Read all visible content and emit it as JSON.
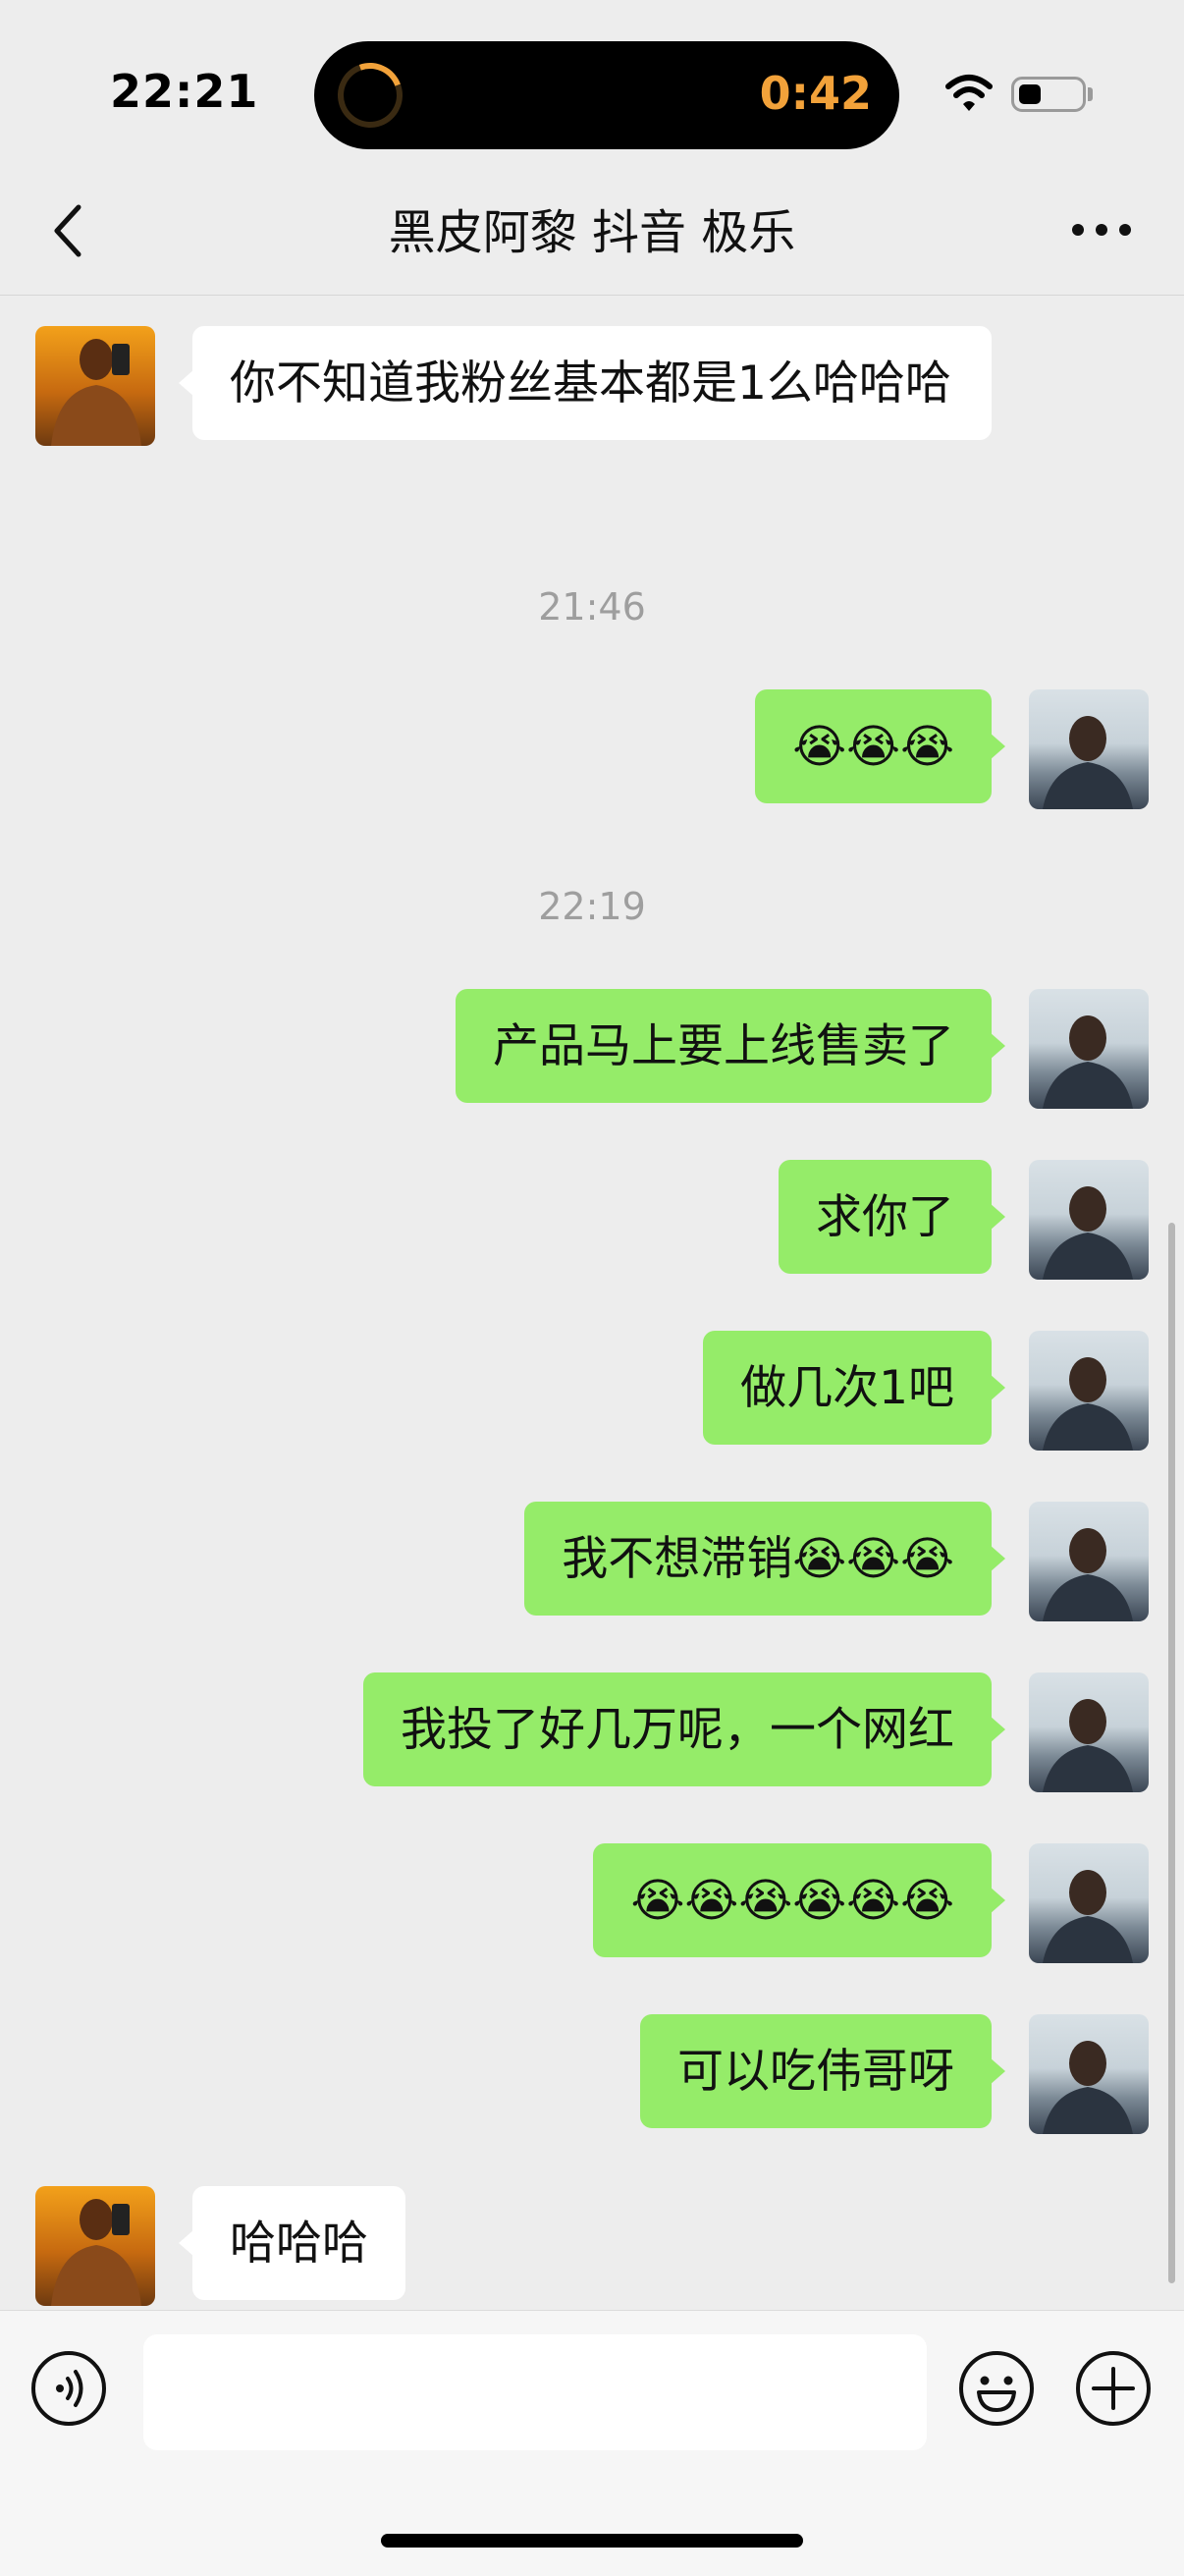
{
  "status_bar": {
    "time": "22:21",
    "island_timer": "0:42",
    "island_timer_color": "#F2A23A"
  },
  "header": {
    "title": "黑皮阿黎 抖音 极乐"
  },
  "colors": {
    "background": "#EDEDED",
    "my_bubble": "#95EC69",
    "peer_bubble": "#FFFFFF",
    "timestamp": "#9E9E9E"
  },
  "messages": [
    {
      "sender": "peer",
      "text": "你不知道我粉丝基本都是1么哈哈哈"
    },
    {
      "type": "time",
      "text": "21:46"
    },
    {
      "sender": "me",
      "text": "😭😭😭"
    },
    {
      "type": "time",
      "text": "22:19"
    },
    {
      "sender": "me",
      "text": "产品马上要上线售卖了"
    },
    {
      "sender": "me",
      "text": "求你了"
    },
    {
      "sender": "me",
      "text": "做几次1吧"
    },
    {
      "sender": "me",
      "text": "我不想滞销😭😭😭"
    },
    {
      "sender": "me",
      "text": "我投了好几万呢，一个网红"
    },
    {
      "sender": "me",
      "text": "😭😭😭😭😭😭"
    },
    {
      "sender": "me",
      "text": "可以吃伟哥呀"
    },
    {
      "sender": "peer",
      "text": "哈哈哈"
    }
  ],
  "input": {
    "placeholder": ""
  },
  "icons": {
    "back": "chevron-left-icon",
    "more": "more-horizontal-icon",
    "voice": "voice-icon",
    "emoji": "smiley-icon",
    "plus": "plus-icon"
  }
}
